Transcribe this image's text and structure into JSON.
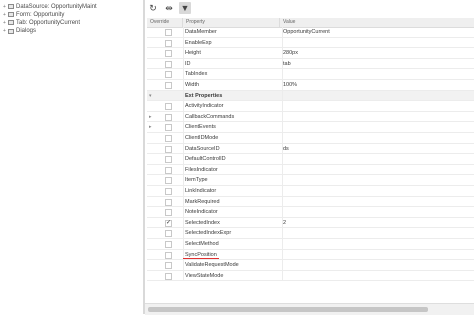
{
  "tree": {
    "nodes": [
      {
        "toggle": "+",
        "label": "DataSource: OpportunityMaint"
      },
      {
        "toggle": "+",
        "label": "Form: Opportunity"
      },
      {
        "toggle": "+",
        "label": "Tab: OpportunityCurrent"
      },
      {
        "toggle": "+",
        "label": "Dialogs"
      }
    ]
  },
  "toolbar": {
    "refresh_glyph": "↻",
    "fit_glyph": "⇹",
    "filter_glyph": "▼"
  },
  "grid": {
    "columns": {
      "override": "Override",
      "property": "Property",
      "value": "Value"
    },
    "rows": [
      {
        "expander": "",
        "checked": false,
        "name": "DataMember",
        "value": "OpportunityCurrent"
      },
      {
        "expander": "",
        "checked": false,
        "name": "EnableExp",
        "value": ""
      },
      {
        "expander": "",
        "checked": false,
        "name": "Height",
        "value": "280px"
      },
      {
        "expander": "",
        "checked": false,
        "name": "ID",
        "value": "tab"
      },
      {
        "expander": "",
        "checked": false,
        "name": "TabIndex",
        "value": ""
      },
      {
        "expander": "",
        "checked": false,
        "name": "Width",
        "value": "100%"
      },
      {
        "expander": "▾",
        "checked": false,
        "name": "Ext Properties",
        "value": "",
        "category": true
      },
      {
        "expander": "",
        "checked": false,
        "name": "ActivityIndicator",
        "value": ""
      },
      {
        "expander": "▸",
        "checked": false,
        "name": "CallbackCommands",
        "value": ""
      },
      {
        "expander": "▸",
        "checked": false,
        "name": "ClientEvents",
        "value": ""
      },
      {
        "expander": "",
        "checked": false,
        "name": "ClientIDMode",
        "value": ""
      },
      {
        "expander": "",
        "checked": false,
        "name": "DataSourceID",
        "value": "ds"
      },
      {
        "expander": "",
        "checked": false,
        "name": "DefaultControlID",
        "value": ""
      },
      {
        "expander": "",
        "checked": false,
        "name": "FilesIndicator",
        "value": ""
      },
      {
        "expander": "",
        "checked": false,
        "name": "ItemType",
        "value": ""
      },
      {
        "expander": "",
        "checked": false,
        "name": "LinkIndicator",
        "value": ""
      },
      {
        "expander": "",
        "checked": false,
        "name": "MarkRequired",
        "value": ""
      },
      {
        "expander": "",
        "checked": false,
        "name": "NoteIndicator",
        "value": ""
      },
      {
        "expander": "",
        "checked": true,
        "name": "SelectedIndex",
        "value": "2"
      },
      {
        "expander": "",
        "checked": false,
        "name": "SelectedIndexExpr",
        "value": ""
      },
      {
        "expander": "",
        "checked": false,
        "name": "SelectMethod",
        "value": ""
      },
      {
        "expander": "",
        "checked": false,
        "name": "SyncPosition",
        "value": ""
      },
      {
        "expander": "",
        "checked": false,
        "name": "ValidateRequestMode",
        "value": ""
      },
      {
        "expander": "",
        "checked": false,
        "name": "ViewStateMode",
        "value": ""
      }
    ]
  },
  "highlight_color": "#e03030"
}
